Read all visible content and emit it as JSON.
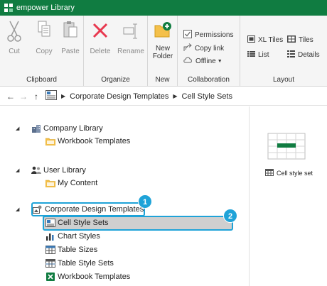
{
  "window": {
    "title": "empower Library"
  },
  "ribbon": {
    "clipboard": {
      "label": "Clipboard",
      "cut": "Cut",
      "copy": "Copy",
      "paste": "Paste"
    },
    "organize": {
      "label": "Organize",
      "delete": "Delete",
      "rename": "Rename"
    },
    "new": {
      "label": "New",
      "new_folder_line1": "New",
      "new_folder_line2": "Folder"
    },
    "collaboration": {
      "label": "Collaboration",
      "permissions": "Permissions",
      "copy_link": "Copy link",
      "offline": "Offline"
    },
    "layout": {
      "label": "Layout",
      "xl_tiles": "XL Tiles",
      "tiles": "Tiles",
      "list": "List",
      "details": "Details"
    }
  },
  "address": {
    "crumbs": [
      "Corporate Design Templates",
      "Cell Style Sets"
    ]
  },
  "tree": {
    "company_library": "Company Library",
    "company_workbook_templates": "Workbook Templates",
    "user_library": "User Library",
    "my_content": "My Content",
    "corporate_design_templates": "Corporate Design Templates",
    "cell_style_sets": "Cell Style Sets",
    "chart_styles": "Chart Styles",
    "table_sizes": "Table Sizes",
    "table_style_sets": "Table Style Sets",
    "workbook_templates": "Workbook Templates"
  },
  "callouts": {
    "one": "1",
    "two": "2"
  },
  "preview": {
    "item_label": "Cell style set"
  },
  "colors": {
    "brand_green": "#107c41",
    "callout_blue": "#1fa3d8",
    "selection_gray": "#cfcfcf",
    "delete_red": "#e8384f"
  },
  "icons": {
    "titlebar": "empower-logo-icon",
    "cut": "scissors-icon",
    "copy": "copy-icon",
    "paste": "clipboard-icon",
    "delete": "red-x-icon",
    "rename": "rename-icon",
    "new_folder": "folder-plus-icon",
    "permissions": "checkbox-icon",
    "copy_link": "share-arrow-icon",
    "offline": "cloud-icon"
  }
}
